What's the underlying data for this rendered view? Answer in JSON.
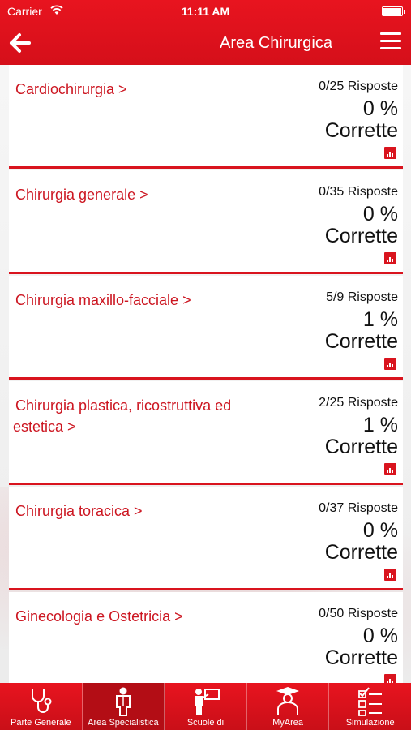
{
  "status_bar": {
    "carrier": "Carrier",
    "time": "11:11 AM"
  },
  "nav": {
    "title": "Area Chirurgica"
  },
  "cards": [
    {
      "name": "Cardiochirurgia >",
      "answers": "0/25 Risposte",
      "percent": "0 %",
      "correct_label": "Corrette"
    },
    {
      "name": "Chirurgia generale >",
      "answers": "0/35 Risposte",
      "percent": "0 %",
      "correct_label": "Corrette"
    },
    {
      "name": "Chirurgia maxillo-facciale >",
      "answers": "5/9 Risposte",
      "percent": "1 %",
      "correct_label": "Corrette"
    },
    {
      "name": "Chirurgia plastica, ricostruttiva ed estetica >",
      "answers": "2/25 Risposte",
      "percent": "1 %",
      "correct_label": "Corrette"
    },
    {
      "name": "Chirurgia toracica >",
      "answers": "0/37 Risposte",
      "percent": "0 %",
      "correct_label": "Corrette"
    },
    {
      "name": "Ginecologia e Ostetricia >",
      "answers": "0/50 Risposte",
      "percent": "0 %",
      "correct_label": "Corrette"
    }
  ],
  "tabs": [
    {
      "label": "Parte Generale",
      "icon": "stethoscope-icon"
    },
    {
      "label": "Area Specialistica",
      "icon": "doctor-icon"
    },
    {
      "label": "Scuole di",
      "icon": "teacher-icon"
    },
    {
      "label": "MyArea",
      "icon": "graduate-icon"
    },
    {
      "label": "Simulazione",
      "icon": "checklist-icon"
    }
  ],
  "colors": {
    "brand_red": "#d9141e",
    "active_tab": "#b30d15"
  }
}
